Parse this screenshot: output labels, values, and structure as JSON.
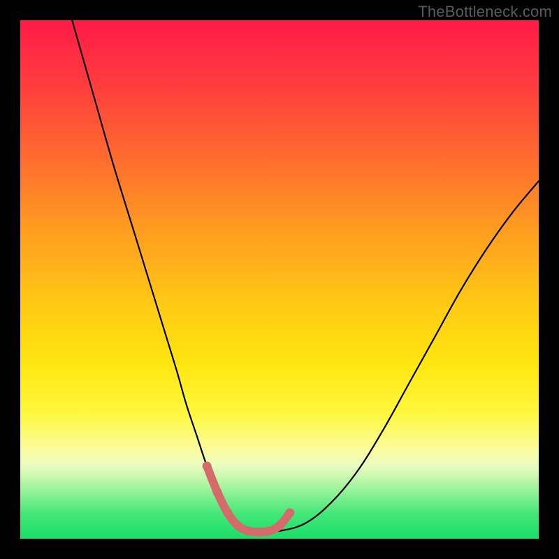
{
  "watermark": "TheBottleneck.com",
  "chart_data": {
    "type": "line",
    "title": "",
    "xlabel": "",
    "ylabel": "",
    "xlim": [
      0,
      100
    ],
    "ylim": [
      0,
      100
    ],
    "grid": false,
    "legend": false,
    "series": [
      {
        "name": "bottleneck-curve",
        "x": [
          10,
          14,
          18,
          22,
          26,
          30,
          32,
          34,
          36,
          38,
          40,
          42,
          44,
          46,
          50,
          55,
          60,
          65,
          70,
          75,
          80,
          85,
          90,
          95,
          100
        ],
        "y": [
          100,
          86,
          72,
          59,
          46,
          33,
          26,
          20,
          14,
          9,
          5,
          2.5,
          1.5,
          1.3,
          1.5,
          3,
          7,
          13,
          21,
          30,
          39,
          48,
          56,
          63,
          69
        ]
      },
      {
        "name": "highlight-region",
        "x": [
          36,
          38,
          40,
          42,
          44,
          46,
          48,
          50,
          52
        ],
        "y": [
          14,
          9,
          5,
          2.5,
          1.5,
          1.3,
          1.5,
          2.5,
          5
        ]
      }
    ],
    "colors": {
      "curve": "#000000",
      "highlight": "#d46a6a",
      "gradient_top": "#ff1a47",
      "gradient_mid": "#ffe60f",
      "gradient_bottom": "#18df68"
    },
    "annotations": []
  }
}
